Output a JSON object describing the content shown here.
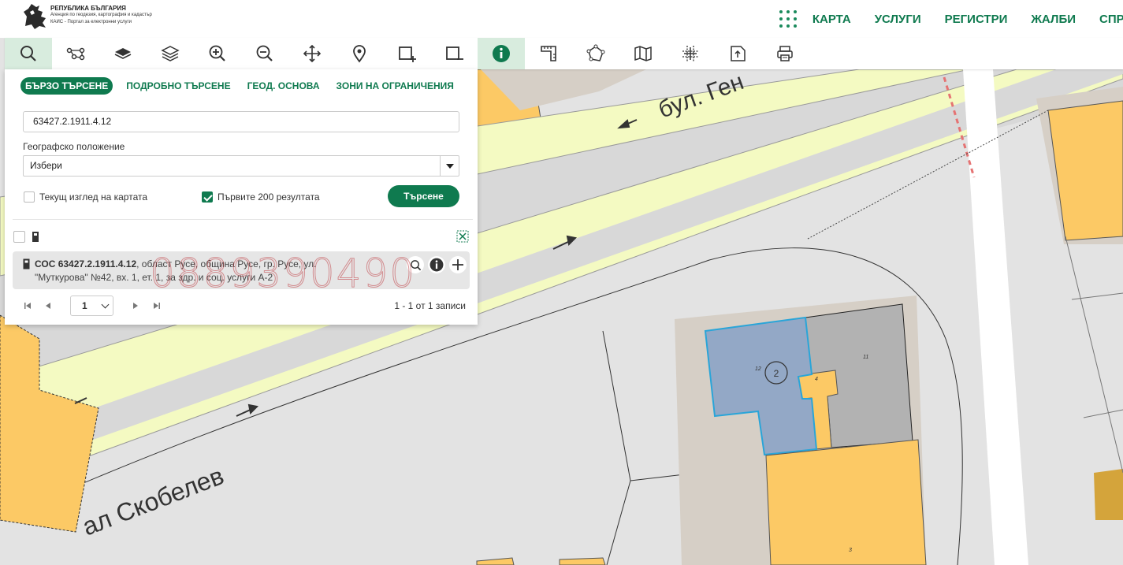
{
  "header": {
    "logo_title": "РЕПУБЛИКА БЪЛГАРИЯ",
    "logo_line2": "Агенция по геодезия, картография и кадастър",
    "logo_line3": "КАИС - Портал за електронни услуги",
    "nav": [
      "КАРТА",
      "УСЛУГИ",
      "РЕГИСТРИ",
      "ЖАЛБИ",
      "СПРАВ"
    ]
  },
  "toolbar": {
    "tools": [
      "search-icon",
      "route-icon",
      "layer-icon",
      "layers-icon",
      "zoom-in-icon",
      "zoom-out-icon",
      "pan-icon",
      "location-pin-icon",
      "select-add-icon",
      "select-remove-icon",
      "info-icon",
      "measure-icon",
      "polygon-icon",
      "map-icon",
      "grid-icon",
      "export-icon",
      "print-icon"
    ],
    "active_color": "#d8ecde"
  },
  "panel": {
    "tabs": [
      "БЪРЗО ТЪРСЕНЕ",
      "ПОДРОБНО ТЪРСЕНЕ",
      "ГЕОД. ОСНОВА",
      "ЗОНИ НА ОГРАНИЧЕНИЯ"
    ],
    "search_value": "63427.2.1911.4.12",
    "geo_label": "Географско положение",
    "geo_select": "Избери",
    "current_view_label": "Текущ изглед на картата",
    "current_view_checked": false,
    "first200_label": "Първите 200 резултата",
    "first200_checked": true,
    "search_button": "Търсене",
    "result": {
      "title": "СОС 63427.2.1911.4.12",
      "line1_rest": ", област Русе, община Русе, гр. Русе, ул.",
      "line2": "\"Муткурова\" №42, вх. 1, ет. 1, за здр. и соц. услуги А-2"
    },
    "pager": {
      "page": "1",
      "info": "1 - 1 от 1 записи"
    }
  },
  "map": {
    "street_top": "бул. Ген",
    "street_bottom": "ал Скобелев",
    "building_label": "2",
    "parcel_labels": [
      "12",
      "11",
      "4",
      "3"
    ]
  },
  "watermark": "0889390490",
  "colors": {
    "accent": "#0f7a4f",
    "road": "#f4fac2",
    "building": "#fcc965",
    "selected": "#93a8c6",
    "grey_building": "#b2b2b2"
  }
}
